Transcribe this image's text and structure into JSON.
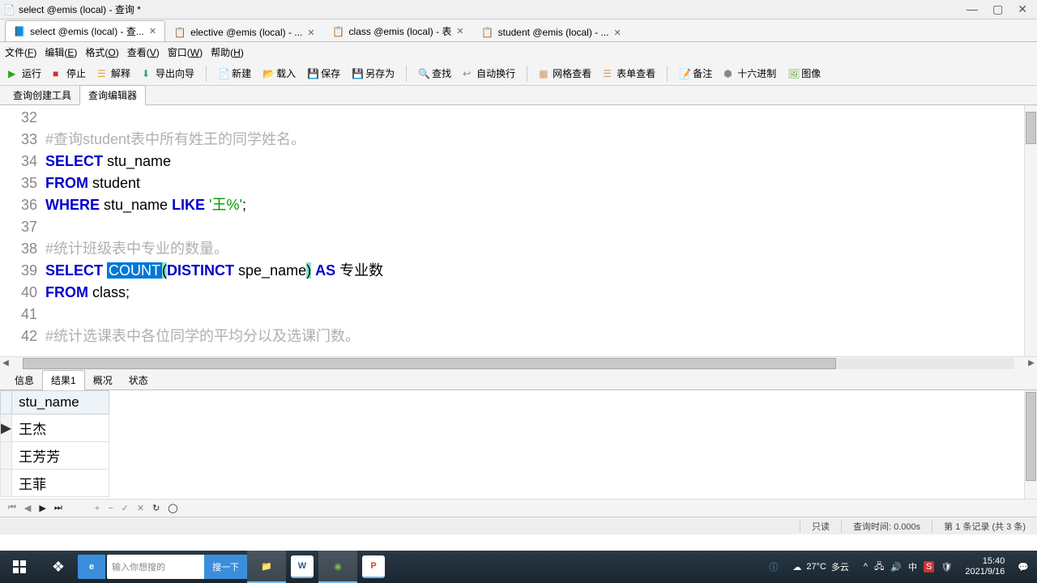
{
  "window": {
    "title": "select @emis (local) - 查询 *"
  },
  "tabs": [
    {
      "label": "select @emis (local) - 查...",
      "active": true
    },
    {
      "label": "elective @emis (local) - ...",
      "active": false
    },
    {
      "label": "class @emis (local) - 表",
      "active": false
    },
    {
      "label": "student @emis (local) - ...",
      "active": false
    }
  ],
  "menus": [
    "文件",
    "编辑",
    "格式",
    "查看",
    "窗口",
    "帮助"
  ],
  "menu_keys": [
    "F",
    "E",
    "O",
    "V",
    "W",
    "H"
  ],
  "toolbar": {
    "run": "运行",
    "stop": "停止",
    "explain": "解释",
    "export": "导出向导",
    "new": "新建",
    "load": "载入",
    "save": "保存",
    "saveas": "另存为",
    "find": "查找",
    "wrap": "自动换行",
    "gridview": "网格查看",
    "formview": "表单查看",
    "note": "备注",
    "hex": "十六进制",
    "image": "图像"
  },
  "subtabs": {
    "builder": "查询创建工具",
    "editor": "查询编辑器"
  },
  "code": {
    "start": 32,
    "lines": [
      {
        "n": 32,
        "t": "plain",
        "text": ""
      },
      {
        "n": 33,
        "t": "cmt",
        "text": "#查询student表中所有姓王的同学姓名。"
      },
      {
        "n": 34,
        "t": "sql1",
        "kw1": "SELECT",
        "rest": " stu_name"
      },
      {
        "n": 35,
        "t": "sql1",
        "kw1": "FROM",
        "rest": " student"
      },
      {
        "n": 36,
        "t": "sql3",
        "kw1": "WHERE",
        "mid": " stu_name ",
        "kw2": "LIKE",
        "str": " '王%'",
        "tail": ";"
      },
      {
        "n": 37,
        "t": "plain",
        "text": ""
      },
      {
        "n": 38,
        "t": "cmt",
        "text": "#统计班级表中专业的数量。"
      },
      {
        "n": 39,
        "t": "count",
        "kw1": "SELECT",
        "count": "COUNT",
        "lp": "(",
        "kw2": "DISTINCT",
        "arg": " spe_name",
        "rp": ")",
        "kw3": "AS",
        "alias": " 专业数"
      },
      {
        "n": 40,
        "t": "sql1",
        "kw1": "FROM",
        "rest": " class;"
      },
      {
        "n": 41,
        "t": "plain",
        "text": ""
      },
      {
        "n": 42,
        "t": "cmt",
        "text": "#统计选课表中各位同学的平均分以及选课门数。"
      }
    ]
  },
  "result_tabs": {
    "info": "信息",
    "r1": "结果1",
    "profile": "概况",
    "status": "状态"
  },
  "grid": {
    "header": "stu_name",
    "rows": [
      "王杰",
      "王芳芳",
      "王菲"
    ]
  },
  "status": {
    "readonly": "只读",
    "qtime": "查询时间: 0.000s",
    "record": "第 1 条记录 (共 3 条)"
  },
  "taskbar": {
    "search_ph": "输入你想搜的",
    "search_btn": "搜一下",
    "weather_temp": "27°C",
    "weather_desc": "多云",
    "time": "15:40",
    "date": "2021/9/16"
  }
}
